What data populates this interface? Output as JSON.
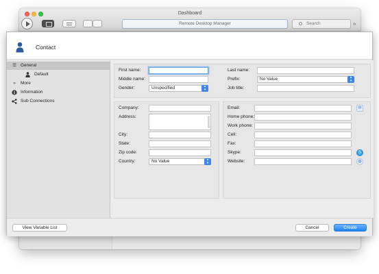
{
  "window": {
    "title": "Dashboard",
    "address_bar": "Remote Desktop Manager",
    "search_placeholder": "Search"
  },
  "dialog": {
    "title": "Contact",
    "sidebar": [
      {
        "icon": "list-icon",
        "label": "General"
      },
      {
        "icon": "person-icon",
        "label": "Default"
      },
      {
        "icon": "double-chevron-icon",
        "label": "More"
      },
      {
        "icon": "info-icon",
        "label": "Information"
      },
      {
        "icon": "connections-icon",
        "label": "Sub Connections"
      }
    ],
    "name_section": {
      "first_name_label": "First name:",
      "first_name_value": "",
      "middle_name_label": "Middle name:",
      "middle_name_value": "",
      "gender_label": "Gender:",
      "gender_value": "Unspecified",
      "last_name_label": "Last name:",
      "last_name_value": "",
      "prefix_label": "Prefix:",
      "prefix_value": "No Value",
      "job_title_label": "Job title:",
      "job_title_value": ""
    },
    "address_section": {
      "company_label": "Company:",
      "address_label": "Address:",
      "city_label": "City:",
      "state_label": "State:",
      "zip_label": "Zip code:",
      "country_label": "Country:",
      "country_value": "No Value"
    },
    "contact_section": {
      "email_label": "Email:",
      "home_phone_label": "Home phone:",
      "work_phone_label": "Work phone:",
      "cell_label": "Cell:",
      "fax_label": "Fax:",
      "skype_label": "Skype:",
      "website_label": "Website:"
    },
    "footer": {
      "view_variable_list": "View Variable List",
      "cancel": "Cancel",
      "create": "Create"
    }
  },
  "colors": {
    "accent": "#1e84f1",
    "focus_ring": "#9cc0ed",
    "sidebar_selected": "#c7c7c7"
  }
}
